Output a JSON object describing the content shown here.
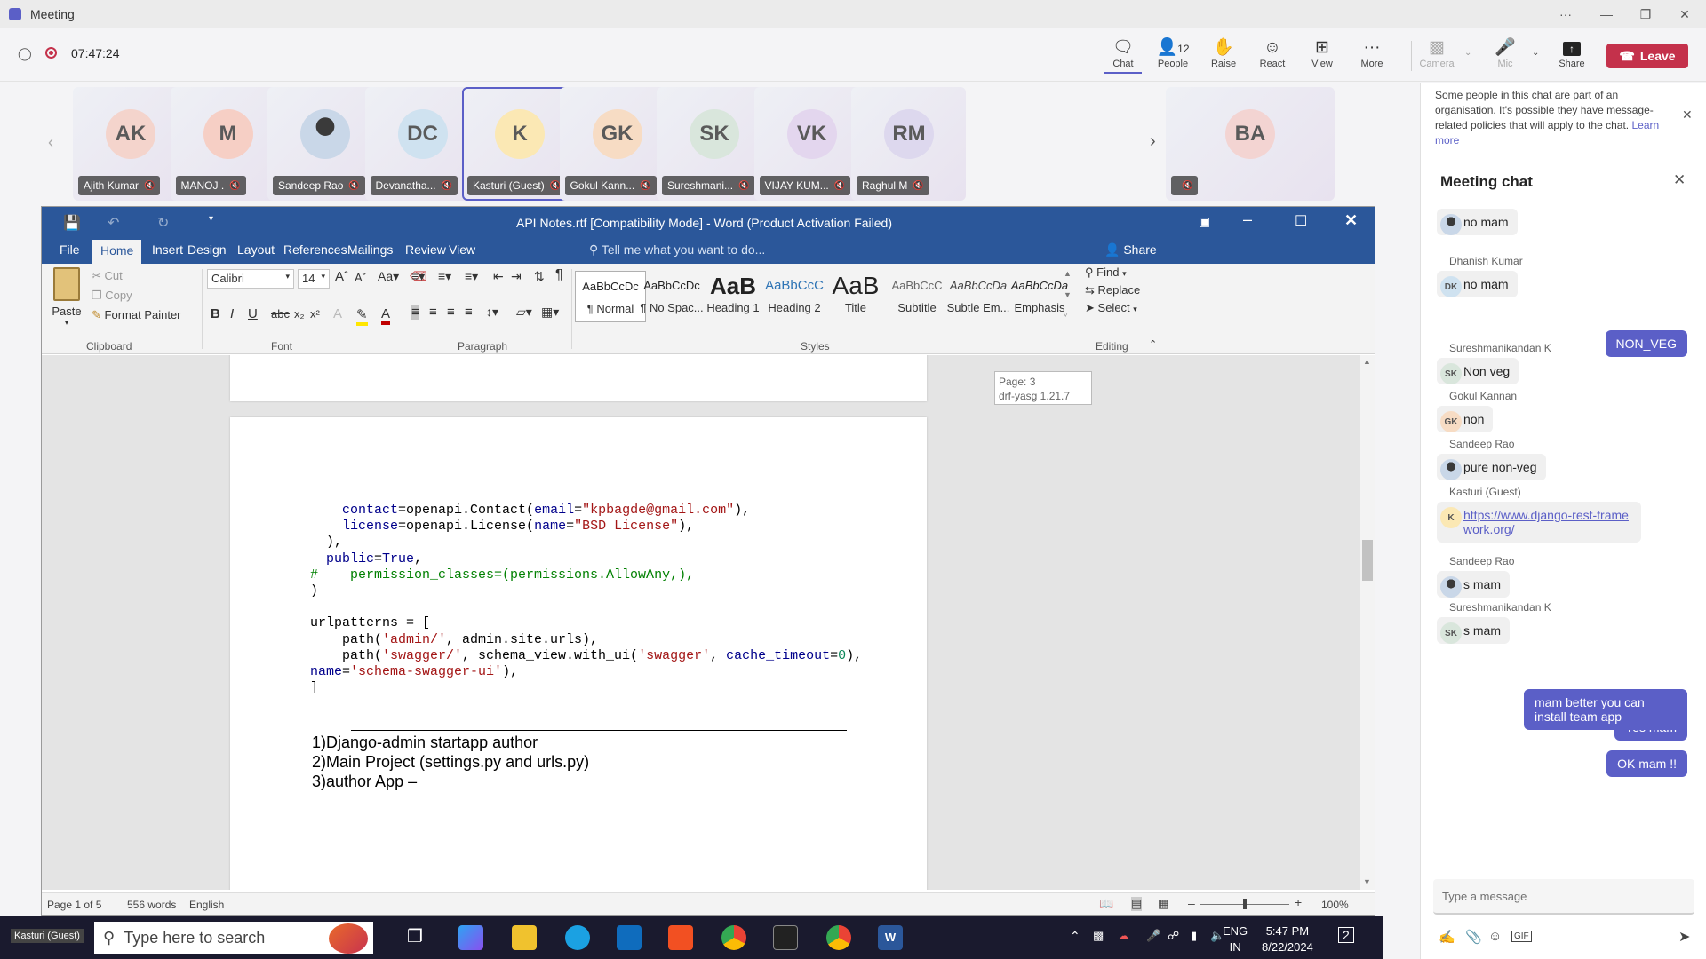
{
  "window": {
    "title": "Meeting",
    "more": "···"
  },
  "meeting": {
    "timer": "07:47:24",
    "buttons": [
      {
        "label": "Chat",
        "icon": "chat-icon"
      },
      {
        "label": "People",
        "icon": "people-icon",
        "count": "12"
      },
      {
        "label": "Raise",
        "icon": "hand-icon"
      },
      {
        "label": "React",
        "icon": "smile-icon"
      },
      {
        "label": "View",
        "icon": "grid-icon"
      },
      {
        "label": "More",
        "icon": "more-icon"
      },
      {
        "label": "Camera",
        "icon": "camera-off-icon"
      },
      {
        "label": "Mic",
        "icon": "mic-off-icon"
      },
      {
        "label": "Share",
        "icon": "share-icon"
      }
    ],
    "leave": "Leave"
  },
  "participants": [
    {
      "initials": "AK",
      "name": "Ajith Kumar",
      "bg": "#f4d4cc"
    },
    {
      "initials": "M",
      "name": "MANOJ .",
      "bg": "#f6cfc5"
    },
    {
      "initials": "",
      "name": "Sandeep Rao",
      "bg": "#c9d7e8"
    },
    {
      "initials": "DC",
      "name": "Devanatha...",
      "bg": "#cfe2f0"
    },
    {
      "initials": "K",
      "name": "Kasturi (Guest)",
      "bg": "#fbe8b4"
    },
    {
      "initials": "GK",
      "name": "Gokul Kann...",
      "bg": "#f7dcc4"
    },
    {
      "initials": "SK",
      "name": "Sureshmani...",
      "bg": "#d9e6dc"
    },
    {
      "initials": "VK",
      "name": "VIJAY KUM...",
      "bg": "#e3d6ee"
    },
    {
      "initials": "RM",
      "name": "Raghul M",
      "bg": "#ddd8ee"
    },
    {
      "initials": "BA",
      "name": "",
      "bg": "#f3d4d2"
    }
  ],
  "word": {
    "title": "API Notes.rtf [Compatibility Mode] - Word (Product Activation Failed)",
    "share": "Share",
    "tabs": [
      "File",
      "Home",
      "Insert",
      "Design",
      "Layout",
      "References",
      "Mailings",
      "Review",
      "View"
    ],
    "tellme": "Tell me what you want to do...",
    "clipboard": {
      "paste": "Paste",
      "cut": "Cut",
      "copy": "Copy",
      "format_painter": "Format Painter",
      "group": "Clipboard"
    },
    "font": {
      "name": "Calibri",
      "size": "14",
      "group": "Font"
    },
    "paragraph_group": "Paragraph",
    "styles": [
      {
        "preview": "AaBbCcDc",
        "name": "¶ Normal"
      },
      {
        "preview": "AaBbCcDc",
        "name": "¶ No Spac..."
      },
      {
        "preview": "AaB",
        "name": "Heading 1"
      },
      {
        "preview": "AaBbCcC",
        "name": "Heading 2"
      },
      {
        "preview": "AaB",
        "name": "Title"
      },
      {
        "preview": "AaBbCcC",
        "name": "Subtitle"
      },
      {
        "preview": "AaBbCcDa",
        "name": "Subtle Em..."
      },
      {
        "preview": "AaBbCcDa",
        "name": "Emphasis"
      }
    ],
    "styles_group": "Styles",
    "editing": {
      "find": "Find",
      "replace": "Replace",
      "select": "Select",
      "group": "Editing"
    },
    "tooltip": {
      "page": "Page: 3",
      "section": "drf-yasg 1.21.7"
    },
    "body": {
      "l1": "1)Django-admin startapp author",
      "l2": "2)Main Project (settings.py and urls.py)",
      "l3": "3)author App –"
    },
    "status": {
      "page": "Page 1 of 5",
      "words": "556 words",
      "lang": "English",
      "zoom": "100%"
    }
  },
  "taskbar": {
    "user": "Kasturi (Guest)",
    "search": "Type here to search",
    "time": "5:47 PM",
    "date": "8/22/2024",
    "lang1": "ENG",
    "lang2": "IN",
    "notif": "2"
  },
  "chat": {
    "banner": "Some people in this chat are part of an organisation. It's possible they have message-related policies that will apply to the chat.",
    "learn": "Learn more",
    "title": "Meeting chat",
    "placeholder": "Type a message",
    "messages": [
      {
        "sender": "",
        "text": "no mam",
        "initials": ""
      },
      {
        "sender": "Dhanish Kumar",
        "text": "no mam",
        "initials": "DK"
      },
      {
        "mine": "NON_VEG"
      },
      {
        "sender": "Sureshmanikandan K",
        "text": "Non veg",
        "initials": "SK"
      },
      {
        "sender": "Gokul Kannan",
        "text": "non",
        "initials": "GK"
      },
      {
        "sender": "Sandeep Rao",
        "text": "pure non-veg",
        "initials": ""
      },
      {
        "sender": "Kasturi (Guest)",
        "text": "https://www.django-rest-framework.org/",
        "initials": "K"
      },
      {
        "sender": "Sandeep Rao",
        "text": "s mam",
        "initials": ""
      },
      {
        "sender": "Sureshmanikandan K",
        "text": "s mam",
        "initials": "SK"
      },
      {
        "mine": "Yes mam"
      },
      {
        "mine": "mam better you can install team app"
      },
      {
        "mine": "OK mam !!"
      }
    ]
  },
  "colors": {
    "teams": "#5b5fc7",
    "word": "#2b579a",
    "leave": "#c4314b"
  }
}
